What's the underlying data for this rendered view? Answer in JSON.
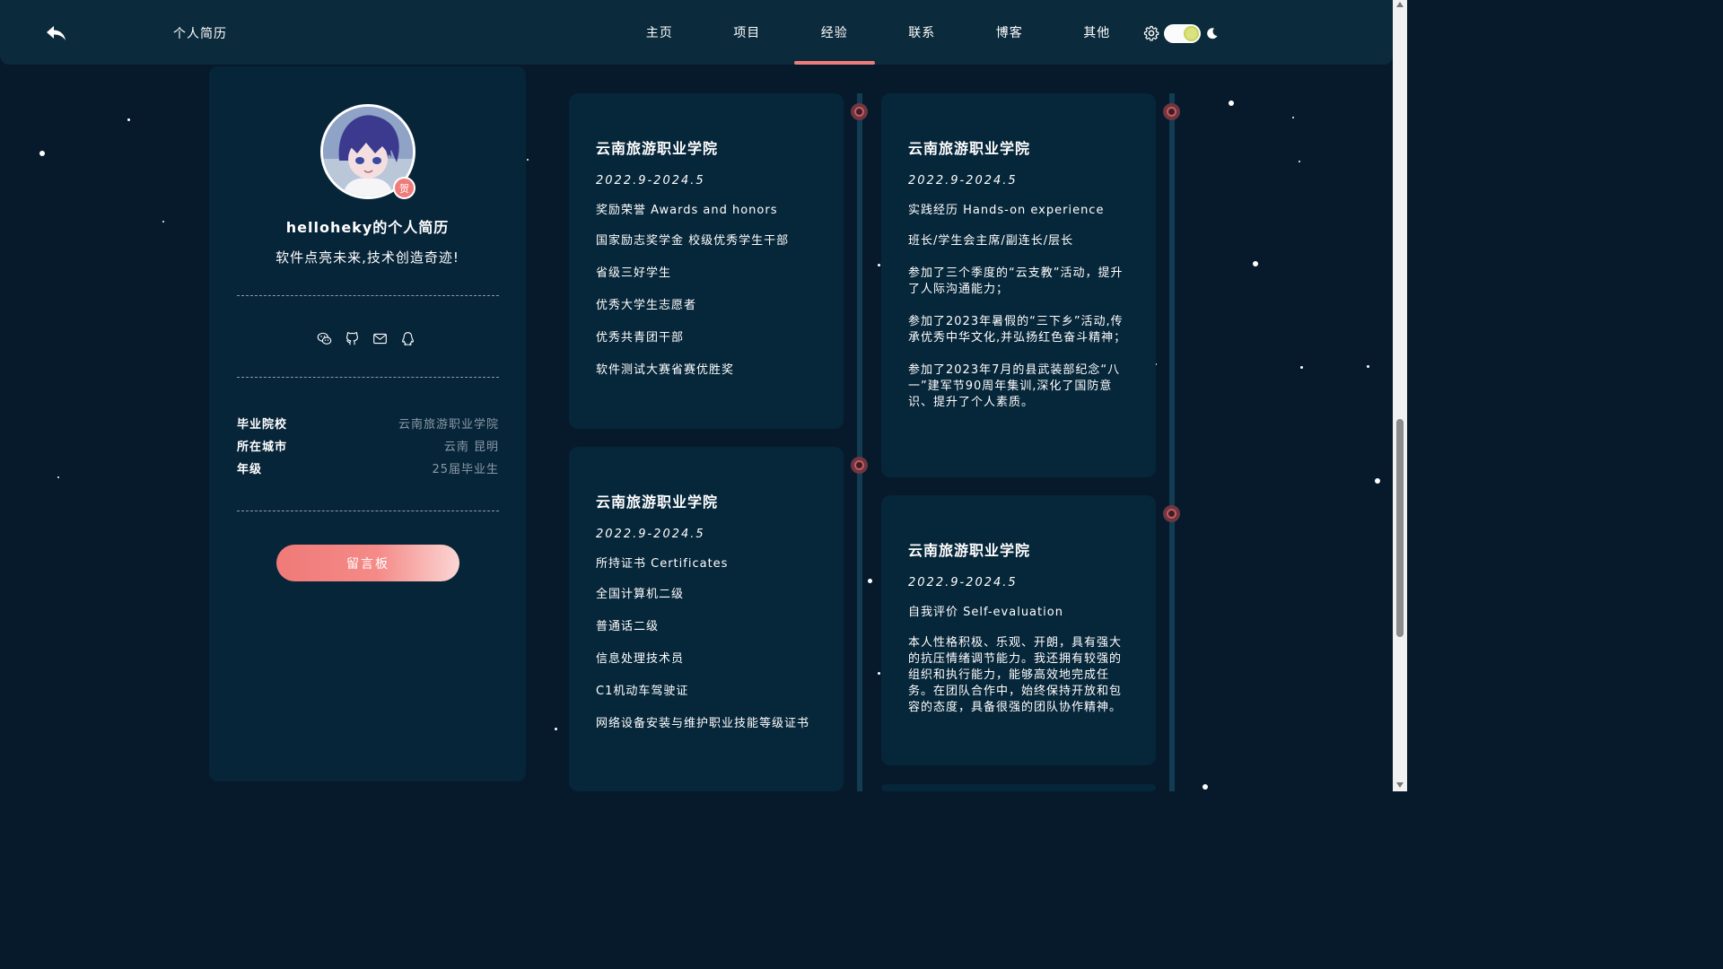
{
  "header": {
    "site_title": "个人简历",
    "nav": [
      {
        "label": "主页"
      },
      {
        "label": "项目"
      },
      {
        "label": "经验"
      },
      {
        "label": "联系"
      },
      {
        "label": "博客"
      },
      {
        "label": "其他"
      }
    ],
    "active_nav": "经验",
    "theme_toggle": "on",
    "accent_color": "#ef7c7a"
  },
  "profile": {
    "badge_text": "贺",
    "name": "helloheky的个人简历",
    "motto": "软件点亮未来,技术创造奇迹!",
    "socials": [
      "wechat-icon",
      "github-icon",
      "mail-icon",
      "qq-icon"
    ],
    "info": [
      {
        "label": "毕业院校",
        "value": "云南旅游职业学院"
      },
      {
        "label": "所在城市",
        "value": "云南 昆明"
      },
      {
        "label": "年级",
        "value": "25届毕业生"
      }
    ],
    "message_button": "留言板"
  },
  "cards": [
    {
      "school": "云南旅游职业学院",
      "date": "2022.9-2024.5",
      "section": "奖励荣誉 Awards and honors",
      "items": [
        "国家励志奖学金 校级优秀学生干部",
        "省级三好学生",
        "优秀大学生志愿者",
        "优秀共青团干部",
        "软件测试大赛省赛优胜奖"
      ]
    },
    {
      "school": "云南旅游职业学院",
      "date": "2022.9-2024.5",
      "section": "所持证书 Certificates",
      "items": [
        "全国计算机二级",
        "普通话二级",
        "信息处理技术员",
        "C1机动车驾驶证",
        "网络设备安装与维护职业技能等级证书"
      ]
    },
    {
      "school": "云南旅游职业学院",
      "date": "2022.9-2024.5",
      "section": "实践经历 Hands-on experience",
      "items": [
        "班长/学生会主席/副连长/层长",
        "参加了三个季度的“云支教”活动，提升了人际沟通能力；",
        "参加了2023年暑假的“三下乡”活动,传承优秀中华文化,并弘扬红色奋斗精神；",
        "参加了2023年7月的县武装部纪念“八一”建军节90周年集训,深化了国防意识、提升了个人素质。"
      ]
    },
    {
      "school": "云南旅游职业学院",
      "date": "2022.9-2024.5",
      "section": "自我评价 Self-evaluation",
      "items": [
        "本人性格积极、乐观、开朗，具有强大的抗压情绪调节能力。我还拥有较强的组织和执行能力，能够高效地完成任务。在团队合作中，始终保持开放和包容的态度，具备很强的团队协作精神。"
      ]
    }
  ]
}
